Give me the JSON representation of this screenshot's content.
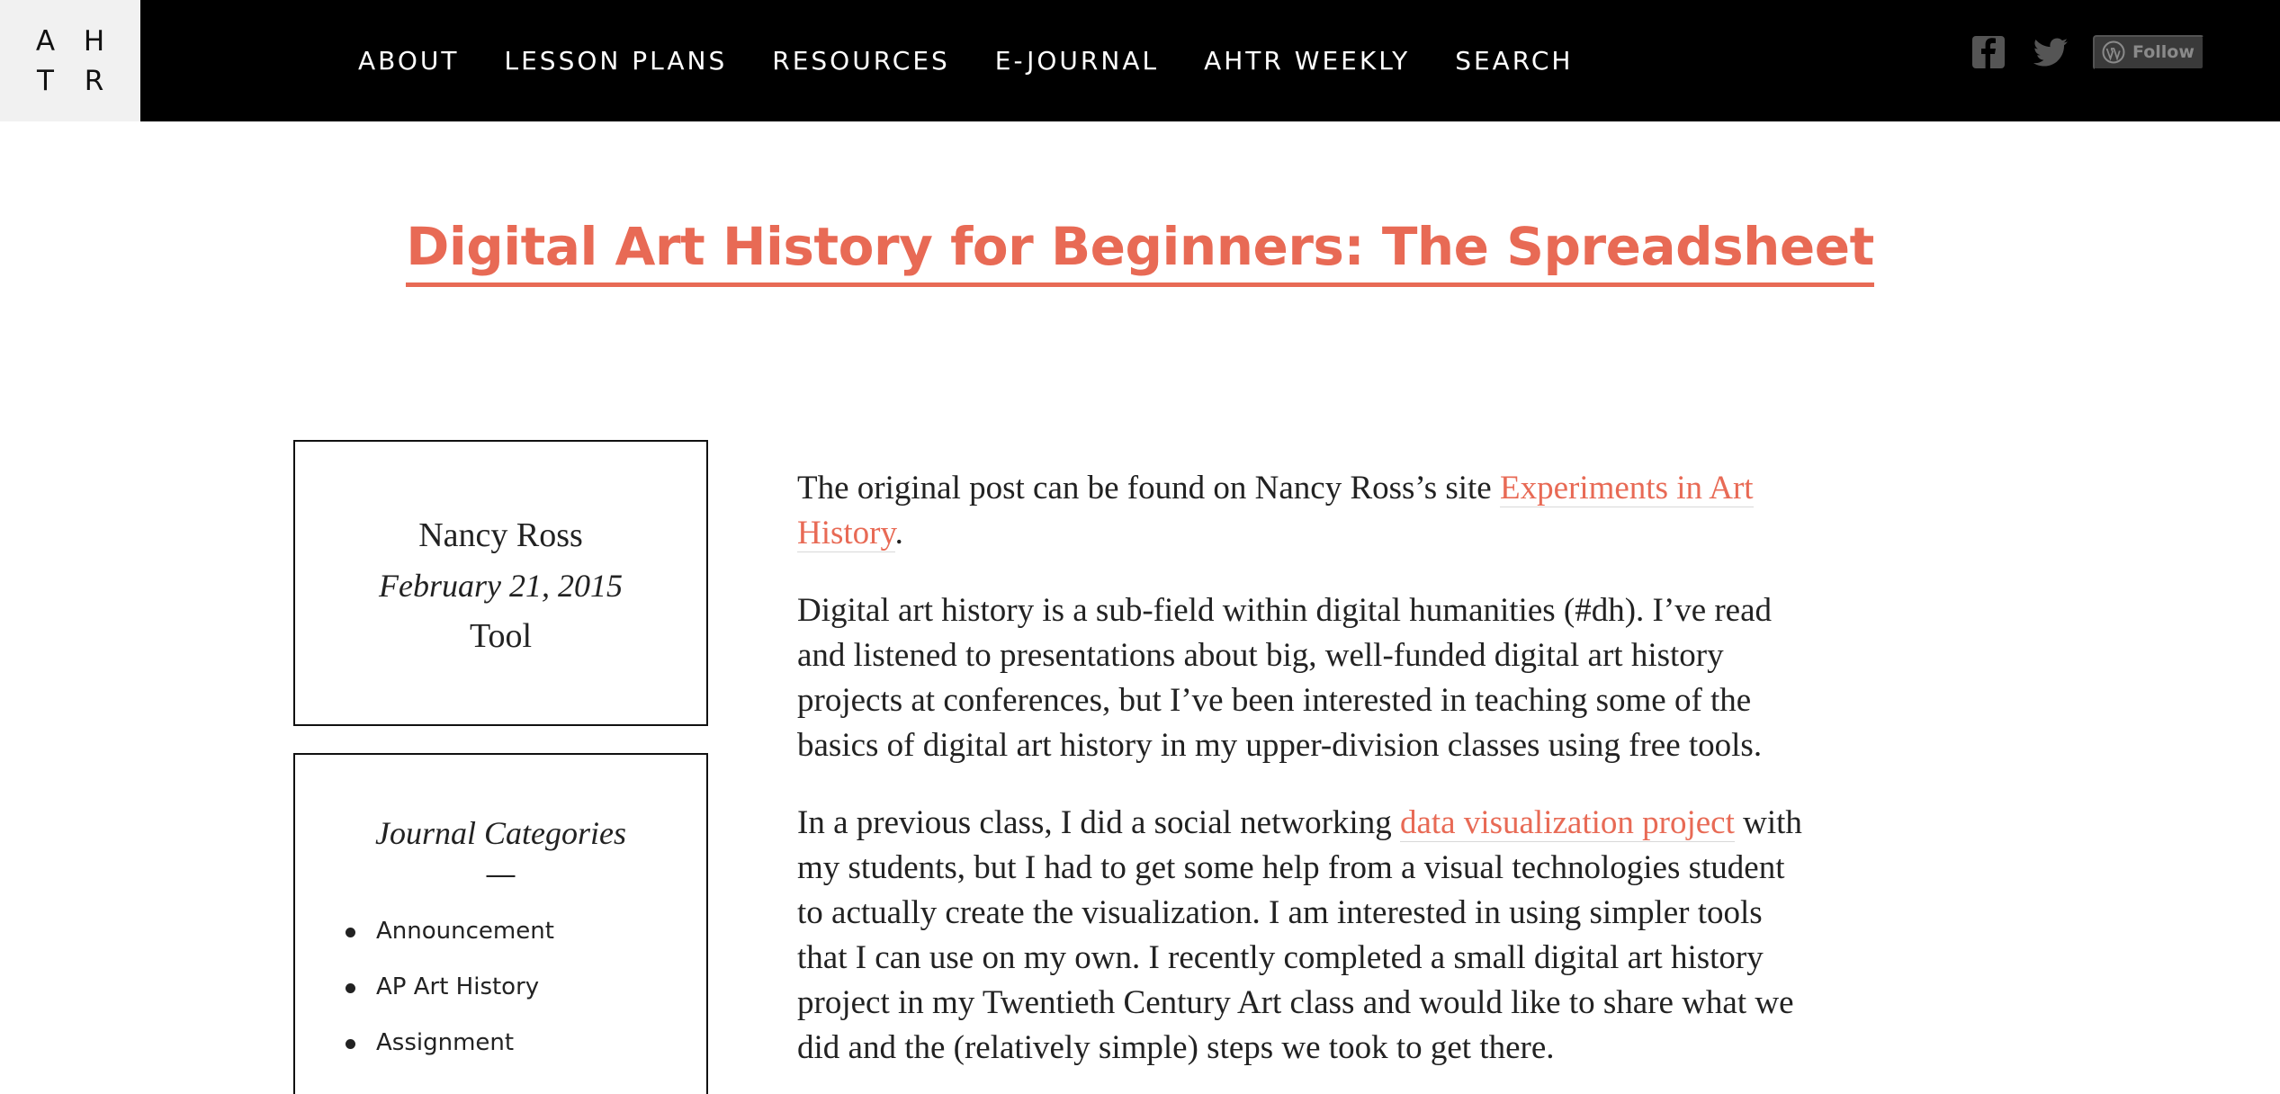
{
  "logo": {
    "letters": [
      "A",
      "H",
      "T",
      "R"
    ]
  },
  "nav": {
    "items": [
      "ABOUT",
      "LESSON PLANS",
      "RESOURCES",
      "E-JOURNAL",
      "AHTR WEEKLY",
      "SEARCH"
    ]
  },
  "social": {
    "facebook_icon": "facebook-icon",
    "twitter_icon": "twitter-icon",
    "follow_label": "Follow"
  },
  "post": {
    "title": "Digital Art History for Beginners: The Spreadsheet"
  },
  "meta": {
    "author": "Nancy Ross",
    "date": "February 21, 2015",
    "tag": "Tool"
  },
  "categories": {
    "heading": "Journal Categories",
    "divider": "—",
    "items": [
      "Announcement",
      "AP Art History",
      "Assignment"
    ]
  },
  "article": {
    "p1_text": "The original post can be found on Nancy Ross’s site ",
    "p1_link": "Experiments in Art History",
    "p1_end": ".",
    "p2": "Digital art history is a sub-field within digital humanities (#dh). I’ve read and listened to presentations about big, well-funded digital art history projects at conferences, but I’ve been interested in teaching some of the basics of digital art history in my upper-division classes using free tools.",
    "p3_start": "In a previous class, I did a social networking ",
    "p3_link": "data visualization project",
    "p3_end": " with my students, but I had to get some help from a visual technologies student to actually create the visualization. I am interested in using simpler tools that I can use on my own. I recently completed a small digital art history project in my Twentieth Century Art class and would like to share what we did and the (relatively simple) steps we took to get there."
  },
  "colors": {
    "accent": "#e86a55",
    "header_bg": "#000000",
    "logo_bg": "#f1f1f1"
  }
}
